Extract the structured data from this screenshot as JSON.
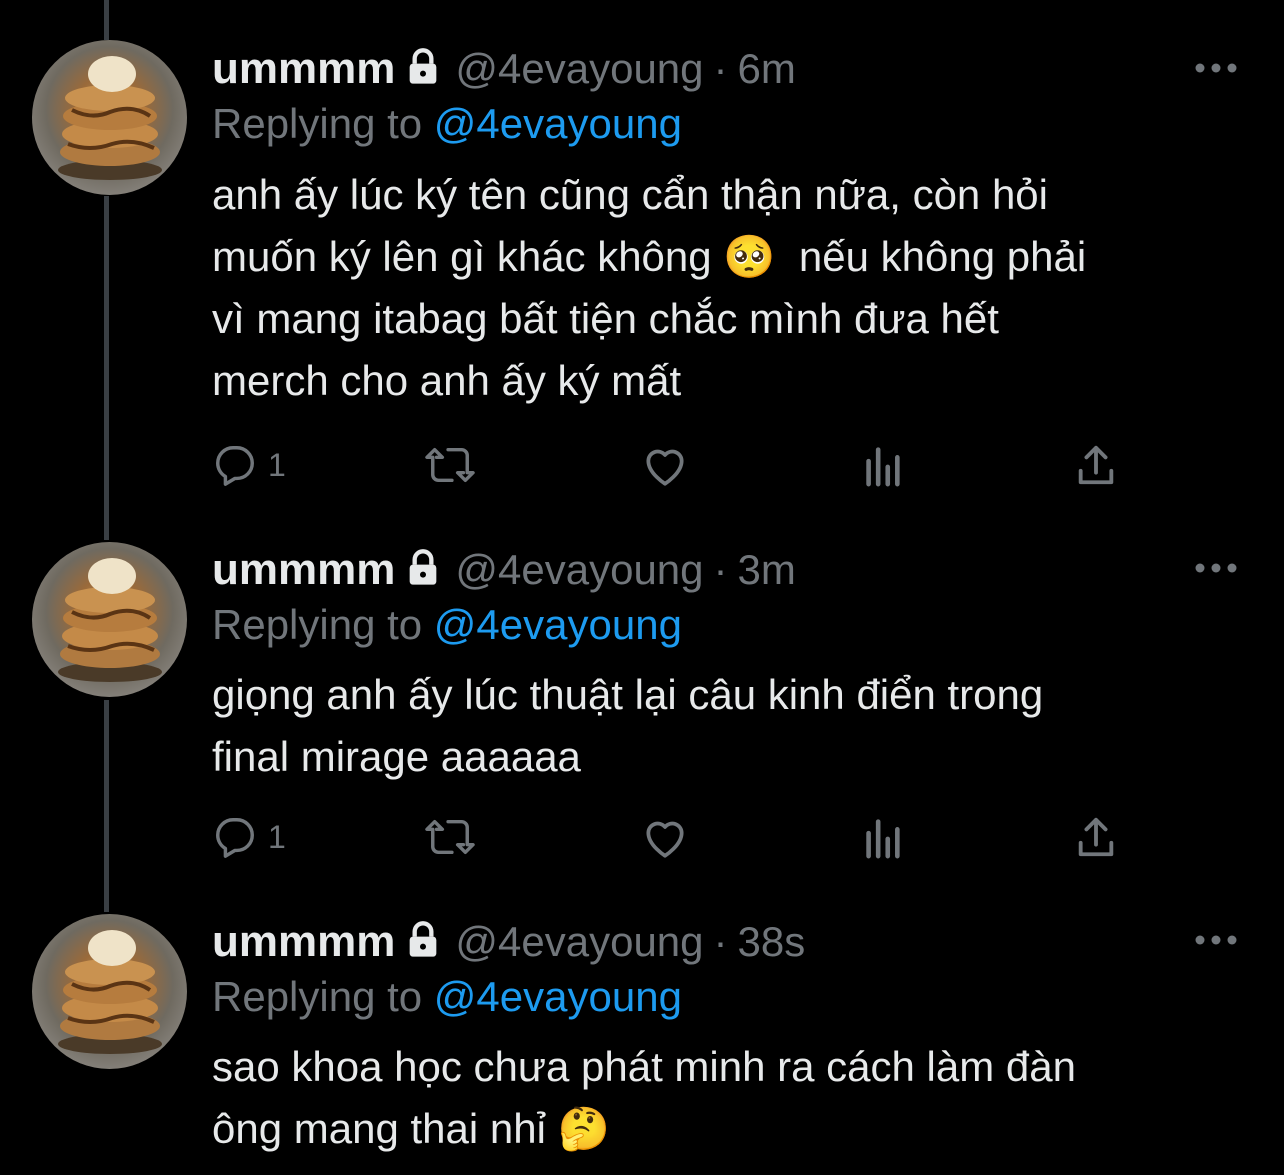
{
  "tweets": [
    {
      "name": "ummmm",
      "handle": "@4evayoung",
      "dot": "·",
      "time": "6m",
      "replying_prefix": "Replying to",
      "replying_to": "@4evayoung",
      "text": "anh ấy lúc ký tên cũng cẩn thận nữa, còn hỏi\nmuốn ký lên gì khác không 🥺  nếu không phải\nvì mang itabag bất tiện chắc mình đưa hết\nmerch cho anh ấy ký mất",
      "reply_count": "1"
    },
    {
      "name": "ummmm",
      "handle": "@4evayoung",
      "dot": "·",
      "time": "3m",
      "replying_prefix": "Replying to",
      "replying_to": "@4evayoung",
      "text": "giọng anh ấy lúc thuật lại câu kinh điển trong\nfinal mirage aaaaaa",
      "reply_count": "1"
    },
    {
      "name": "ummmm",
      "handle": "@4evayoung",
      "dot": "·",
      "time": "38s",
      "replying_prefix": "Replying to",
      "replying_to": "@4evayoung",
      "text": "sao khoa học chưa phát minh ra cách làm đàn\nông mang thai nhỉ 🤔"
    }
  ],
  "icons": {
    "lock": "lock-icon",
    "more": "more-icon",
    "reply": "reply-icon",
    "retweet": "retweet-icon",
    "like": "like-icon",
    "views": "views-icon",
    "share": "share-icon"
  },
  "colors": {
    "background": "#000000",
    "text": "#e7e9ea",
    "secondary": "#71767b",
    "accent": "#1d9bf0",
    "thread_line": "#3a3f44"
  }
}
